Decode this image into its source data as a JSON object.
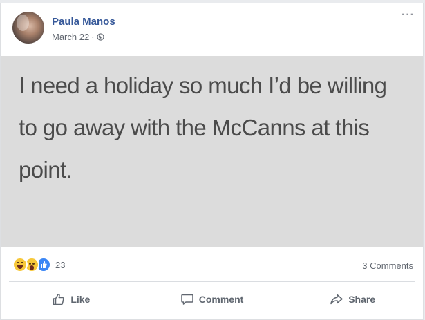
{
  "post": {
    "author": "Paula Manos",
    "date": "March 22",
    "separator": "·",
    "privacy_icon": "globe-icon",
    "more_icon": "more-options-icon",
    "status_text": "I need a holiday so much I’d be willing to go away with the McCanns at this point."
  },
  "reactions": {
    "types": [
      "haha",
      "wow",
      "like"
    ],
    "count": "23",
    "comments": "3 Comments"
  },
  "actions": {
    "like_label": "Like",
    "comment_label": "Comment",
    "share_label": "Share"
  },
  "colors": {
    "author_link": "#365899",
    "status_background": "#dcdcdc",
    "status_text": "#4b4b4b",
    "action_text": "#606770"
  }
}
